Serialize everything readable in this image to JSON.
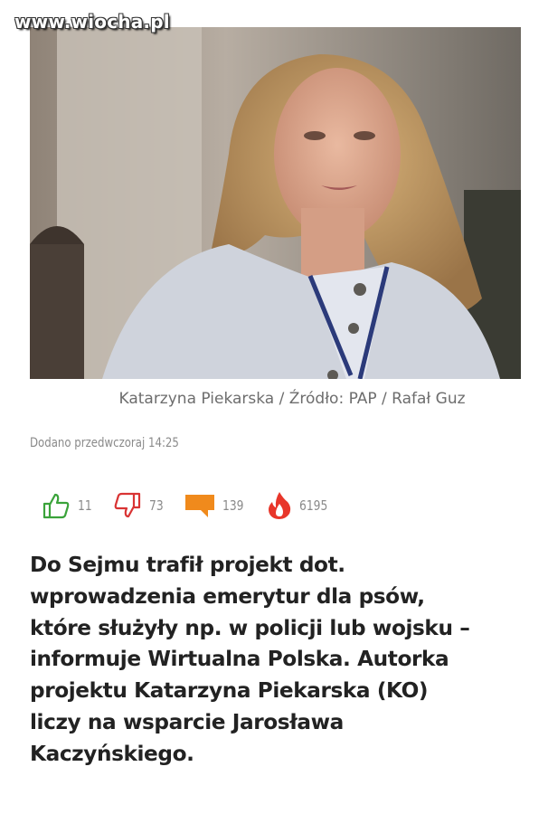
{
  "watermark": "www.wiocha.pl",
  "photo_caption": "Katarzyna Piekarska / Źródło: PAP / Rafał Guz",
  "dateline": "Dodano przedwczoraj 14:25",
  "stats": {
    "likes": "11",
    "dislikes": "73",
    "comments": "139",
    "hot": "6195"
  },
  "colors": {
    "like": "#3aa33a",
    "dislike": "#d93434",
    "comment": "#f08a1c",
    "hot": "#e8362a"
  },
  "icons": [
    "thumbs-up-icon",
    "thumbs-down-icon",
    "comment-icon",
    "flame-icon"
  ],
  "article_text": "Do Sejmu trafił projekt dot.\nwprowadzenia emerytur dla psów,\nktóre służyły np. w policji lub wojsku –\n informuje Wirtualna Polska. Autorka\nprojektu Katarzyna Piekarska (KO)\nliczy na wsparcie Jarosława\nKaczyńskiego."
}
